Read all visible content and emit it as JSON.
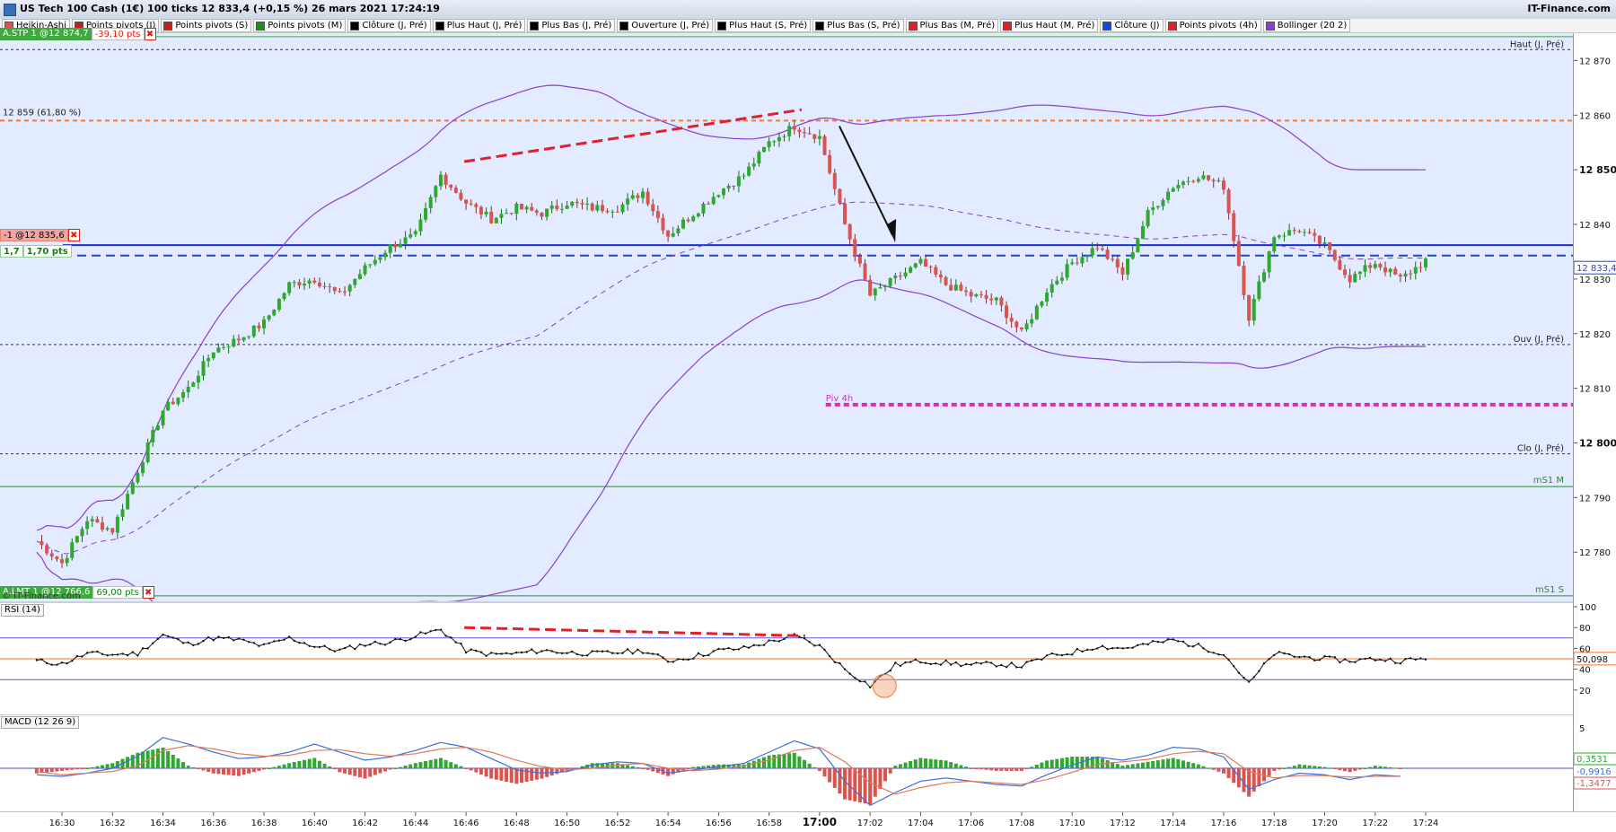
{
  "window": {
    "title": "US Tech 100 Cash (1€) 100 ticks 12 833,4 (+0,15 %) 26 mars 2021 17:24:19",
    "brand": "IT-Finance.com"
  },
  "legend": [
    {
      "label": "Heikin-Ashi",
      "color": "#d9534f"
    },
    {
      "label": "Points pivots (J)",
      "color": "#c21f1f"
    },
    {
      "label": "Points pivots (S)",
      "color": "#c21f1f"
    },
    {
      "label": "Points pivots (M)",
      "color": "#1a8f1a"
    },
    {
      "label": "Clôture (J, Pré)",
      "color": "#000000"
    },
    {
      "label": "Plus Haut (J, Pré)",
      "color": "#000000"
    },
    {
      "label": "Plus Bas (J, Pré)",
      "color": "#000000"
    },
    {
      "label": "Ouverture (J, Pré)",
      "color": "#000000"
    },
    {
      "label": "Plus Haut (S, Pré)",
      "color": "#000000"
    },
    {
      "label": "Plus Bas (S, Pré)",
      "color": "#000000"
    },
    {
      "label": "Plus Bas (M, Pré)",
      "color": "#e0202a"
    },
    {
      "label": "Plus Haut (M, Pré)",
      "color": "#e0202a"
    },
    {
      "label": "Clôture (J)",
      "color": "#1a44e0"
    },
    {
      "label": "Points pivots (4h)",
      "color": "#e0202a"
    },
    {
      "label": "Bollinger (20 2)",
      "color": "#8a3fd1"
    }
  ],
  "orders": {
    "stop": {
      "label": "A.STP 1 @12 874,7",
      "pts": "-39,10 pts"
    },
    "position": {
      "label": "-1 @12 835,6",
      "qty": "1,7",
      "pts": "1,70 pts"
    },
    "limit": {
      "label": "A.LMT 1 @12 766,6",
      "pts": "69,00 pts"
    },
    "copyright": "© IT-Finance.com"
  },
  "level_labels": {
    "fib": "12 859 (61,80 %)",
    "high_prev": "Haut (J, Pré)",
    "open_prev": "Ouv (J, Pré)",
    "close_prev": "Clo (J, Pré)",
    "piv4h": "Piv 4h",
    "ms1m": "mS1 M",
    "ms1s": "mS1 S"
  },
  "price_axis": {
    "ticks": [
      "12 870",
      "12 860",
      "12 850",
      "12 840",
      "12 830",
      "12 820",
      "12 810",
      "12 800",
      "12 790",
      "12 780"
    ],
    "bold_ticks": [
      "12 850",
      "12 800"
    ],
    "last_price": "12 833,4"
  },
  "rsi": {
    "label": "RSI (14)",
    "ticks": [
      "100",
      "80",
      "60",
      "40",
      "20"
    ],
    "current": "50,098"
  },
  "macd": {
    "label": "MACD (12 26 9)",
    "ticks": [
      "5"
    ],
    "value_signal": "0,3531",
    "value_macd": "-0,9916",
    "value_hist": "-1,3477"
  },
  "time_axis": [
    "16:30",
    "16:32",
    "16:34",
    "16:36",
    "16:38",
    "16:40",
    "16:42",
    "16:44",
    "16:46",
    "16:48",
    "16:50",
    "16:52",
    "16:54",
    "16:56",
    "16:58",
    "17:00",
    "17:02",
    "17:04",
    "17:06",
    "17:08",
    "17:10",
    "17:12",
    "17:14",
    "17:16",
    "17:18",
    "17:20",
    "17:22",
    "17:24"
  ],
  "chart_data": {
    "type": "line",
    "instrument": "US Tech 100 Cash (1€) 100 ticks",
    "ylim": [
      12771,
      12875
    ],
    "price_anchors": [
      [
        "16:29",
        12782
      ],
      [
        "16:30",
        12778
      ],
      [
        "16:31",
        12786
      ],
      [
        "16:32",
        12784
      ],
      [
        "16:33",
        12795
      ],
      [
        "16:34",
        12806
      ],
      [
        "16:35",
        12810
      ],
      [
        "16:36",
        12817
      ],
      [
        "16:37",
        12819
      ],
      [
        "16:38",
        12822
      ],
      [
        "16:39",
        12829
      ],
      [
        "16:40",
        12830
      ],
      [
        "16:41",
        12827
      ],
      [
        "16:42",
        12832
      ],
      [
        "16:43",
        12836
      ],
      [
        "16:44",
        12838
      ],
      [
        "16:45",
        12849
      ],
      [
        "16:46",
        12844
      ],
      [
        "16:47",
        12841
      ],
      [
        "16:48",
        12843
      ],
      [
        "16:49",
        12842
      ],
      [
        "16:50",
        12844
      ],
      [
        "16:51",
        12843
      ],
      [
        "16:52",
        12843
      ],
      [
        "16:53",
        12846
      ],
      [
        "16:54",
        12838
      ],
      [
        "16:55",
        12842
      ],
      [
        "16:56",
        12846
      ],
      [
        "16:57",
        12849
      ],
      [
        "16:58",
        12855
      ],
      [
        "16:59",
        12858
      ],
      [
        "17:00",
        12856
      ],
      [
        "17:01",
        12840
      ],
      [
        "17:02",
        12827
      ],
      [
        "17:03",
        12830
      ],
      [
        "17:04",
        12833
      ],
      [
        "17:05",
        12829
      ],
      [
        "17:06",
        12827
      ],
      [
        "17:07",
        12826
      ],
      [
        "17:08",
        12820
      ],
      [
        "17:09",
        12828
      ],
      [
        "17:10",
        12833
      ],
      [
        "17:11",
        12836
      ],
      [
        "17:12",
        12831
      ],
      [
        "17:13",
        12842
      ],
      [
        "17:14",
        12847
      ],
      [
        "17:15",
        12849
      ],
      [
        "17:16",
        12847
      ],
      [
        "17:17",
        12823
      ],
      [
        "17:18",
        12838
      ],
      [
        "17:19",
        12839
      ],
      [
        "17:20",
        12836
      ],
      [
        "17:21",
        12830
      ],
      [
        "17:22",
        12833
      ],
      [
        "17:23",
        12830
      ],
      [
        "17:24",
        12833.4
      ]
    ],
    "levels": {
      "haut_j_pre": 12872,
      "fib_61_8": 12859,
      "stop_order": 12874.7,
      "cloture_j": 12836.2,
      "position": 12835.6,
      "ouv_j_pre": 12818,
      "piv_4h": 12807,
      "clo_j_pre": 12798,
      "ms1_m": 12792,
      "ms1_s": 12772,
      "limit_order": 12766.6
    },
    "rsi_series": [
      [
        "16:29",
        48
      ],
      [
        "16:30",
        45
      ],
      [
        "16:31",
        55
      ],
      [
        "16:32",
        54
      ],
      [
        "16:33",
        55
      ],
      [
        "16:34",
        73
      ],
      [
        "16:35",
        64
      ],
      [
        "16:36",
        70
      ],
      [
        "16:37",
        68
      ],
      [
        "16:38",
        62
      ],
      [
        "16:39",
        70
      ],
      [
        "16:40",
        62
      ],
      [
        "16:41",
        58
      ],
      [
        "16:42",
        64
      ],
      [
        "16:43",
        66
      ],
      [
        "16:44",
        72
      ],
      [
        "16:45",
        78
      ],
      [
        "16:46",
        58
      ],
      [
        "16:47",
        54
      ],
      [
        "16:48",
        55
      ],
      [
        "16:49",
        58
      ],
      [
        "16:50",
        56
      ],
      [
        "16:51",
        55
      ],
      [
        "16:52",
        56
      ],
      [
        "16:53",
        58
      ],
      [
        "16:54",
        48
      ],
      [
        "16:55",
        52
      ],
      [
        "16:56",
        58
      ],
      [
        "16:57",
        60
      ],
      [
        "16:58",
        66
      ],
      [
        "16:59",
        72
      ],
      [
        "17:00",
        62
      ],
      [
        "17:01",
        40
      ],
      [
        "17:02",
        24
      ],
      [
        "17:03",
        44
      ],
      [
        "17:04",
        48
      ],
      [
        "17:05",
        46
      ],
      [
        "17:06",
        44
      ],
      [
        "17:07",
        45
      ],
      [
        "17:08",
        43
      ],
      [
        "17:09",
        52
      ],
      [
        "17:10",
        56
      ],
      [
        "17:11",
        62
      ],
      [
        "17:12",
        60
      ],
      [
        "17:13",
        64
      ],
      [
        "17:14",
        68
      ],
      [
        "17:15",
        62
      ],
      [
        "17:16",
        55
      ],
      [
        "17:17",
        26
      ],
      [
        "17:18",
        55
      ],
      [
        "17:19",
        52
      ],
      [
        "17:20",
        50
      ],
      [
        "17:21",
        48
      ],
      [
        "17:22",
        50
      ],
      [
        "17:23",
        48
      ],
      [
        "17:24",
        50.1
      ]
    ],
    "macd_series": [
      [
        "16:29",
        -0.8,
        -0.4
      ],
      [
        "16:30",
        -1.0,
        -0.8
      ],
      [
        "16:31",
        -0.6,
        -0.6
      ],
      [
        "16:32",
        0.0,
        -0.4
      ],
      [
        "16:33",
        1.5,
        0.3
      ],
      [
        "16:34",
        3.8,
        2.2
      ],
      [
        "16:35",
        3.0,
        2.8
      ],
      [
        "16:36",
        2.0,
        2.4
      ],
      [
        "16:37",
        1.2,
        1.8
      ],
      [
        "16:38",
        1.4,
        1.5
      ],
      [
        "16:39",
        2.0,
        1.6
      ],
      [
        "16:40",
        3.0,
        2.2
      ],
      [
        "16:41",
        2.0,
        2.3
      ],
      [
        "16:42",
        1.0,
        1.8
      ],
      [
        "16:43",
        1.4,
        1.5
      ],
      [
        "16:44",
        2.2,
        1.8
      ],
      [
        "16:45",
        3.2,
        2.4
      ],
      [
        "16:46",
        2.6,
        2.6
      ],
      [
        "16:47",
        1.2,
        2.0
      ],
      [
        "16:48",
        -0.2,
        1.0
      ],
      [
        "16:49",
        -0.6,
        0.2
      ],
      [
        "16:50",
        -0.4,
        -0.2
      ],
      [
        "16:51",
        0.4,
        0.0
      ],
      [
        "16:52",
        0.8,
        0.4
      ],
      [
        "16:53",
        0.6,
        0.6
      ],
      [
        "16:54",
        -0.6,
        0.0
      ],
      [
        "16:55",
        -0.2,
        -0.3
      ],
      [
        "16:56",
        0.2,
        -0.1
      ],
      [
        "16:57",
        0.6,
        0.3
      ],
      [
        "16:58",
        2.0,
        1.0
      ],
      [
        "16:59",
        3.4,
        2.2
      ],
      [
        "17:00",
        2.4,
        2.6
      ],
      [
        "17:01",
        -1.6,
        0.8
      ],
      [
        "17:02",
        -4.6,
        -1.8
      ],
      [
        "17:03",
        -3.0,
        -3.2
      ],
      [
        "17:04",
        -1.6,
        -2.4
      ],
      [
        "17:05",
        -1.2,
        -1.8
      ],
      [
        "17:06",
        -1.6,
        -1.6
      ],
      [
        "17:07",
        -2.0,
        -1.8
      ],
      [
        "17:08",
        -2.2,
        -2.0
      ],
      [
        "17:09",
        -0.8,
        -1.4
      ],
      [
        "17:10",
        0.4,
        -0.5
      ],
      [
        "17:11",
        1.4,
        0.5
      ],
      [
        "17:12",
        1.0,
        0.8
      ],
      [
        "17:13",
        1.6,
        1.1
      ],
      [
        "17:14",
        2.6,
        1.8
      ],
      [
        "17:15",
        2.4,
        2.1
      ],
      [
        "17:16",
        1.4,
        1.8
      ],
      [
        "17:17",
        -2.6,
        -0.4
      ],
      [
        "17:18",
        -1.4,
        -1.2
      ],
      [
        "17:19",
        -0.6,
        -0.9
      ],
      [
        "17:20",
        -0.8,
        -0.9
      ],
      [
        "17:21",
        -1.4,
        -1.1
      ],
      [
        "17:22",
        -0.8,
        -1.0
      ],
      [
        "17:23",
        -1.0,
        -1.0
      ],
      [
        "17:24",
        -0.99,
        0.35
      ]
    ]
  }
}
